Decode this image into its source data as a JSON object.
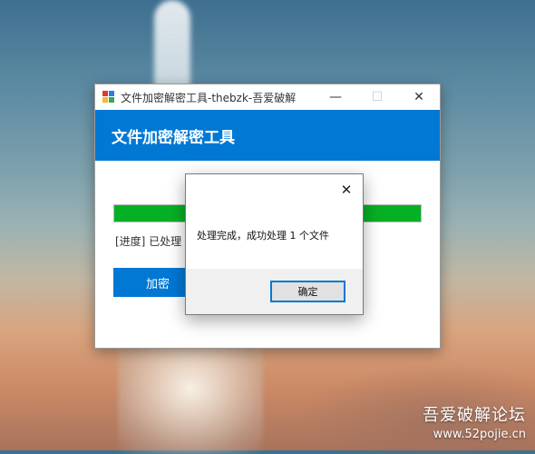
{
  "window": {
    "title": "文件加密解密工具-thebzk-吾爱破解",
    "minimize_glyph": "—",
    "maximize_glyph": "☐",
    "close_glyph": "✕"
  },
  "banner": {
    "heading": "文件加密解密工具"
  },
  "main": {
    "progress": 1.0,
    "progress_color": "#06b025",
    "status_prefix": "[进度]",
    "status_text": "已处理",
    "encrypt_label": "加密"
  },
  "dialog": {
    "close_glyph": "✕",
    "message": "处理完成，成功处理 1 个文件",
    "ok_label": "确定"
  },
  "watermark": {
    "title": "吾爱破解论坛",
    "url": "www.52pojie.cn"
  },
  "colors": {
    "accent": "#0078d4"
  }
}
